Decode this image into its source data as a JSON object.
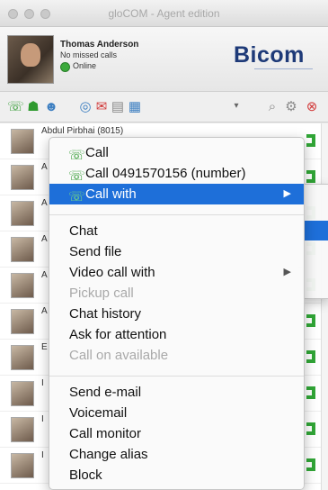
{
  "window": {
    "title": "gloCOM - Agent edition"
  },
  "user": {
    "name": "Thomas Anderson",
    "subtitle": "No missed calls",
    "status": "Online"
  },
  "brand": {
    "name": "Bicom"
  },
  "toolbar": {
    "icons": [
      "call-icon",
      "contacts-icon",
      "group-icon",
      "globe-icon",
      "message-icon",
      "fax-icon",
      "voicemail-icon",
      "dropdown-icon",
      "search-icon",
      "settings-icon",
      "close-icon"
    ]
  },
  "contacts": [
    {
      "name": "Abdul Pirbhai (8015)"
    },
    {
      "name": "A"
    },
    {
      "name": "A"
    },
    {
      "name": "A"
    },
    {
      "name": "A"
    },
    {
      "name": "A"
    },
    {
      "name": "E"
    },
    {
      "name": "I"
    },
    {
      "name": "I"
    },
    {
      "name": "I"
    }
  ],
  "context_menu": {
    "call": "Call",
    "call_number": "Call 0491570156 (number)",
    "call_with": "Call with",
    "chat": "Chat",
    "send_file": "Send file",
    "video_call_with": "Video call with",
    "pickup_call": "Pickup call",
    "chat_history": "Chat history",
    "ask_for_attention": "Ask for attention",
    "call_on_available": "Call on available",
    "send_email": "Send e-mail",
    "voicemail": "Voicemail",
    "call_monitor": "Call monitor",
    "change_alias": "Change alias",
    "block": "Block"
  },
  "colors": {
    "selection": "#1e6fd9",
    "accent_green": "#2f9a2f",
    "brand_blue": "#1e3a78"
  }
}
